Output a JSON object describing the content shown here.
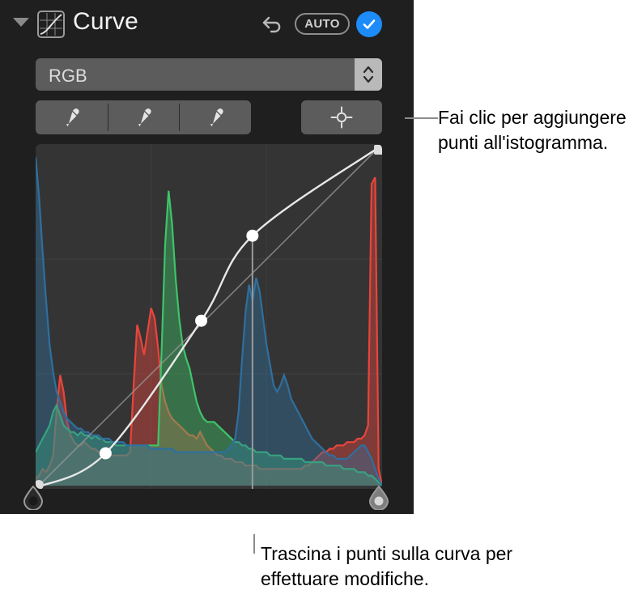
{
  "panel": {
    "title": "Curve",
    "icon": "curve-icon",
    "disclosure": "disclosure-triangle-collapsed",
    "undo_icon": "undo-arrow-icon",
    "auto_label": "AUTO",
    "apply_icon": "checkmark-icon",
    "accent_color": "#1d8cf8",
    "background_color": "#1f1f1f",
    "plot_background_color": "#343434"
  },
  "channel": {
    "value": "RGB",
    "stepper_icon": "chevron-up-down-icon",
    "options": [
      "RGB"
    ]
  },
  "pickers": {
    "items": [
      {
        "name": "black-point-eyedropper",
        "icon": "eyedropper-icon"
      },
      {
        "name": "gray-point-eyedropper",
        "icon": "eyedropper-icon"
      },
      {
        "name": "white-point-eyedropper",
        "icon": "eyedropper-icon"
      }
    ],
    "target_button": {
      "name": "add-point-target",
      "icon": "crosshair-target-icon"
    }
  },
  "handles": {
    "black_point": "black-point-handle",
    "white_point": "white-point-handle"
  },
  "callouts": {
    "top": "Fai clic per aggiungere punti all'istogramma.",
    "bottom": "Trascina i punti sulla curva per effettuare modifiche."
  },
  "chart_data": {
    "type": "area",
    "title": "Curve",
    "xlabel": "",
    "ylabel": "",
    "xlim": [
      0,
      255
    ],
    "ylim": [
      0,
      1
    ],
    "grid": true,
    "legend": "none",
    "colors": {
      "red": "#e8453c",
      "green": "#3ec46a",
      "blue": "#2f6f9e",
      "curve": "#e8e8e8",
      "reference_line": "#9a9a9a",
      "grid": "#3f3f3f"
    },
    "curve_points": [
      {
        "name": "black-point",
        "x": 0,
        "y": 0
      },
      {
        "name": "shadow-point",
        "x": 0.2,
        "y": 0.1
      },
      {
        "name": "midtone-point",
        "x": 0.48,
        "y": 0.49
      },
      {
        "name": "highlight-point",
        "x": 0.63,
        "y": 0.74
      },
      {
        "name": "white-point",
        "x": 1,
        "y": 1
      }
    ],
    "series": [
      {
        "name": "Red",
        "color": "#e8453c",
        "values": [
          0.02,
          0.03,
          0.05,
          0.04,
          0.06,
          0.09,
          0.22,
          0.33,
          0.28,
          0.19,
          0.15,
          0.13,
          0.12,
          0.12,
          0.13,
          0.12,
          0.11,
          0.11,
          0.1,
          0.1,
          0.09,
          0.09,
          0.09,
          0.09,
          0.09,
          0.09,
          0.09,
          0.1,
          0.3,
          0.48,
          0.44,
          0.39,
          0.46,
          0.53,
          0.5,
          0.41,
          0.3,
          0.25,
          0.22,
          0.2,
          0.19,
          0.18,
          0.17,
          0.16,
          0.15,
          0.15,
          0.14,
          0.16,
          0.14,
          0.12,
          0.11,
          0.1,
          0.09,
          0.09,
          0.08,
          0.08,
          0.08,
          0.07,
          0.07,
          0.07,
          0.06,
          0.06,
          0.06,
          0.06,
          0.05,
          0.05,
          0.05,
          0.05,
          0.05,
          0.05,
          0.05,
          0.05,
          0.05,
          0.05,
          0.05,
          0.05,
          0.05,
          0.06,
          0.06,
          0.07,
          0.08,
          0.09,
          0.1,
          0.1,
          0.11,
          0.11,
          0.12,
          0.12,
          0.12,
          0.13,
          0.13,
          0.13,
          0.14,
          0.14,
          0.15,
          0.18,
          0.9,
          0.92,
          0.05,
          0.0
        ]
      },
      {
        "name": "Green",
        "color": "#3ec46a",
        "values": [
          0.1,
          0.12,
          0.14,
          0.16,
          0.18,
          0.22,
          0.24,
          0.21,
          0.18,
          0.17,
          0.16,
          0.16,
          0.15,
          0.16,
          0.15,
          0.15,
          0.14,
          0.15,
          0.14,
          0.14,
          0.13,
          0.13,
          0.13,
          0.12,
          0.12,
          0.12,
          0.12,
          0.12,
          0.12,
          0.12,
          0.12,
          0.12,
          0.12,
          0.12,
          0.12,
          0.12,
          0.4,
          0.72,
          0.88,
          0.78,
          0.62,
          0.5,
          0.42,
          0.38,
          0.35,
          0.3,
          0.25,
          0.22,
          0.2,
          0.19,
          0.19,
          0.19,
          0.18,
          0.17,
          0.16,
          0.15,
          0.14,
          0.13,
          0.13,
          0.12,
          0.12,
          0.11,
          0.11,
          0.1,
          0.1,
          0.1,
          0.1,
          0.09,
          0.09,
          0.09,
          0.09,
          0.08,
          0.08,
          0.08,
          0.08,
          0.08,
          0.08,
          0.07,
          0.07,
          0.07,
          0.07,
          0.07,
          0.07,
          0.06,
          0.06,
          0.06,
          0.06,
          0.06,
          0.05,
          0.05,
          0.05,
          0.05,
          0.04,
          0.04,
          0.04,
          0.03,
          0.03,
          0.02,
          0.01,
          0.0
        ]
      },
      {
        "name": "Blue",
        "color": "#2f6f9e",
        "values": [
          0.98,
          0.86,
          0.7,
          0.55,
          0.42,
          0.34,
          0.28,
          0.25,
          0.22,
          0.2,
          0.19,
          0.18,
          0.17,
          0.17,
          0.16,
          0.16,
          0.15,
          0.15,
          0.15,
          0.14,
          0.14,
          0.14,
          0.13,
          0.13,
          0.13,
          0.13,
          0.12,
          0.12,
          0.12,
          0.12,
          0.12,
          0.12,
          0.12,
          0.11,
          0.11,
          0.11,
          0.11,
          0.11,
          0.11,
          0.11,
          0.1,
          0.1,
          0.1,
          0.1,
          0.1,
          0.1,
          0.1,
          0.1,
          0.1,
          0.1,
          0.1,
          0.1,
          0.1,
          0.1,
          0.1,
          0.11,
          0.12,
          0.14,
          0.22,
          0.38,
          0.52,
          0.6,
          0.55,
          0.62,
          0.58,
          0.5,
          0.42,
          0.36,
          0.3,
          0.28,
          0.3,
          0.33,
          0.3,
          0.26,
          0.24,
          0.22,
          0.2,
          0.18,
          0.16,
          0.14,
          0.13,
          0.12,
          0.11,
          0.1,
          0.09,
          0.09,
          0.08,
          0.08,
          0.08,
          0.08,
          0.09,
          0.1,
          0.11,
          0.12,
          0.12,
          0.1,
          0.08,
          0.05,
          0.02,
          0.0
        ]
      }
    ]
  }
}
